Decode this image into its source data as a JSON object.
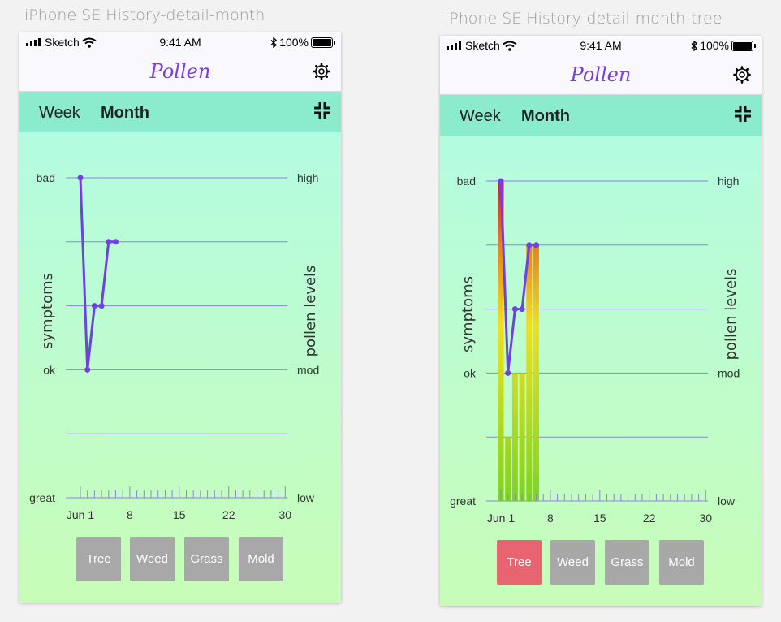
{
  "artboards": [
    {
      "title": "iPhone SE History-detail-month",
      "status": {
        "carrier": "Sketch",
        "time": "9:41 AM",
        "battery": "100%"
      },
      "nav": {
        "title": "Pollen"
      },
      "tabs": [
        {
          "label": "Week",
          "active": false
        },
        {
          "label": "Month",
          "active": true
        }
      ],
      "filters": [
        {
          "label": "Tree",
          "active": false
        },
        {
          "label": "Weed",
          "active": false
        },
        {
          "label": "Grass",
          "active": false
        },
        {
          "label": "Mold",
          "active": false
        }
      ]
    },
    {
      "title": "iPhone SE History-detail-month-tree",
      "status": {
        "carrier": "Sketch",
        "time": "9:41 AM",
        "battery": "100%"
      },
      "nav": {
        "title": "Pollen"
      },
      "tabs": [
        {
          "label": "Week",
          "active": false
        },
        {
          "label": "Month",
          "active": true
        }
      ],
      "filters": [
        {
          "label": "Tree",
          "active": true
        },
        {
          "label": "Weed",
          "active": false
        },
        {
          "label": "Grass",
          "active": false
        },
        {
          "label": "Mold",
          "active": false
        }
      ]
    }
  ],
  "chart": {
    "left_axis_title": "symptoms",
    "right_axis_title": "pollen levels",
    "left_labels": [
      {
        "label": "bad",
        "level": 5
      },
      {
        "label": "ok",
        "level": 2
      },
      {
        "label": "great",
        "level": 0
      }
    ],
    "right_labels": [
      {
        "label": "high",
        "level": 5
      },
      {
        "label": "mod",
        "level": 2
      },
      {
        "label": "low",
        "level": 0
      }
    ],
    "x_labels": [
      {
        "label": "Jun 1",
        "day": 1
      },
      {
        "label": "8",
        "day": 8
      },
      {
        "label": "15",
        "day": 15
      },
      {
        "label": "22",
        "day": 22
      },
      {
        "label": "30",
        "day": 30
      }
    ]
  },
  "chart_data": [
    {
      "type": "line",
      "series": [
        {
          "x": [
            1,
            2,
            3,
            4,
            5,
            6
          ],
          "values": [
            5,
            2,
            3,
            3,
            4,
            4
          ]
        }
      ],
      "xlim": [
        1,
        30
      ],
      "ylim": [
        0,
        5
      ],
      "grid": true
    },
    {
      "type": "bar+line",
      "bar_values": [
        5,
        1,
        2,
        2,
        4,
        4
      ],
      "series": [
        {
          "x": [
            1,
            2,
            3,
            4,
            5,
            6
          ],
          "values": [
            5,
            2,
            3,
            3,
            4,
            4
          ]
        }
      ],
      "xlim": [
        1,
        30
      ],
      "ylim": [
        0,
        5
      ],
      "grid": true
    }
  ],
  "colors": {
    "accent": "#7b3fe0",
    "line": "#7040e0",
    "grid": "#8f82dc",
    "tab_bg": "#8aeccc",
    "button_inactive": "#a8a8a8",
    "button_active": "#e86470",
    "bar_low": "#7ed321",
    "bar_mid": "#f0e020",
    "bar_high": "#d01e2e"
  }
}
